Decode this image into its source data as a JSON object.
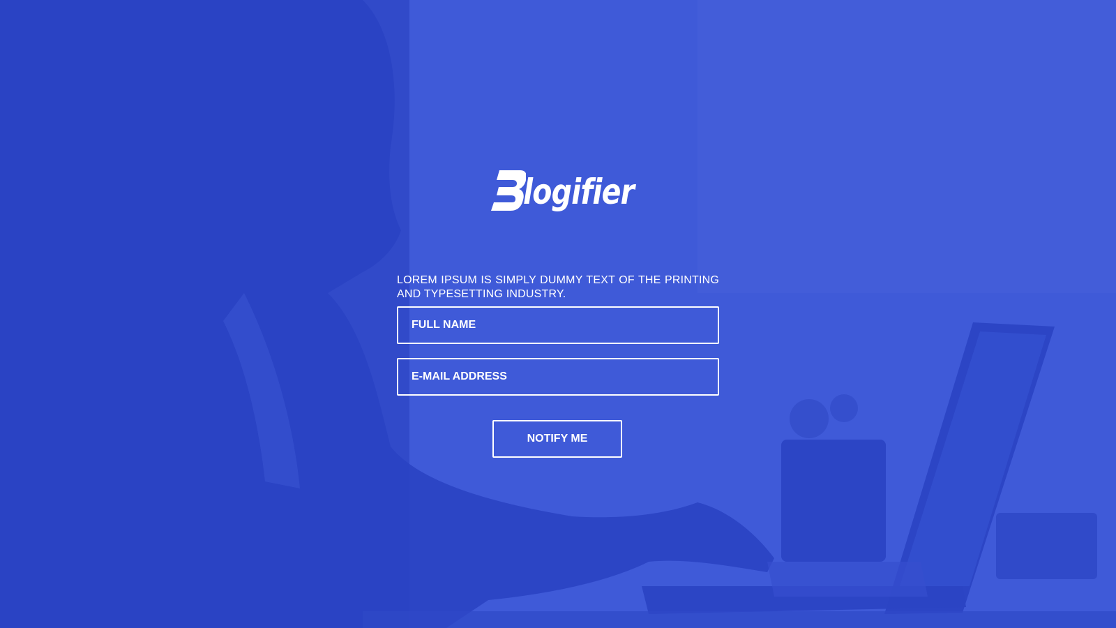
{
  "brand": {
    "name": "logifier",
    "mark_icon": "b-logo-icon",
    "accent_color": "#3f5ad8",
    "foreground_color": "#ffffff"
  },
  "hero": {
    "tagline": "LOREM IPSUM IS SIMPLY DUMMY TEXT OF THE PRINTING AND TYPESETTING INDUSTRY."
  },
  "form": {
    "full_name_placeholder": "FULL NAME",
    "email_placeholder": "E-MAIL ADDRESS",
    "notify_label": "NOTIFY ME"
  }
}
